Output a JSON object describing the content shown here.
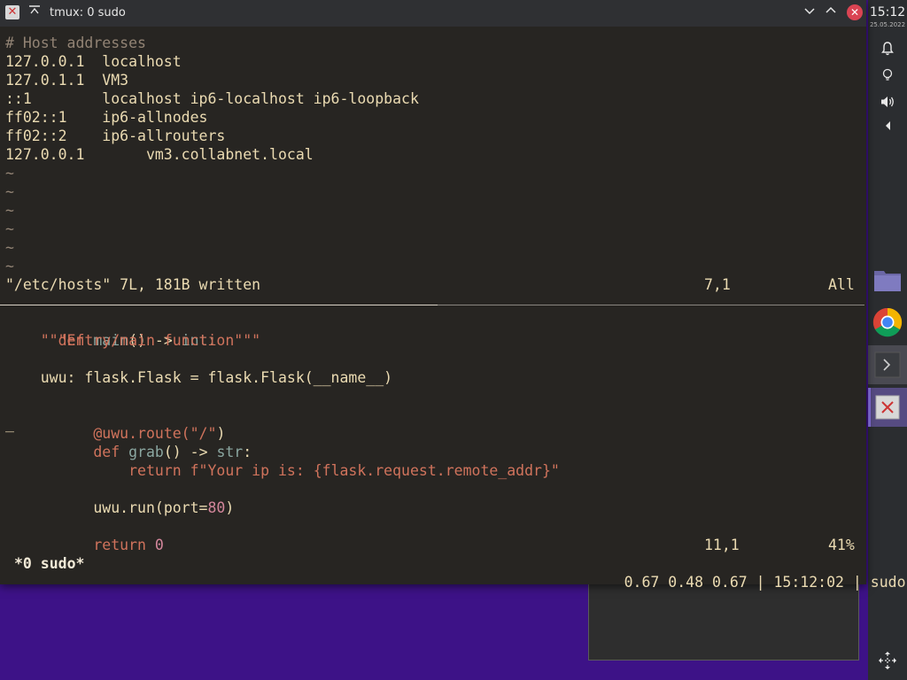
{
  "window": {
    "title": "tmux: 0 sudo"
  },
  "top_pane": {
    "lines": [
      "# Host addresses",
      "127.0.0.1  localhost",
      "127.0.1.1  VM3",
      "::1        localhost ip6-localhost ip6-loopback",
      "ff02::1    ip6-allnodes",
      "ff02::2    ip6-allrouters",
      "127.0.0.1       vm3.collabnet.local"
    ],
    "tilde": "~",
    "status_message": "\"/etc/hosts\" 7L, 181B written",
    "cursor_pos": "7,1",
    "scroll": "All"
  },
  "bottom_pane": {
    "code": {
      "l1_kw": "def",
      "l1_name": "main",
      "l1_rest": "() -> ",
      "l1_type": "int",
      "l1_colon": ":",
      "l2": "    \"\"\"Entry/main function\"\"\"",
      "l4": "    uwu: flask.Flask = flask.Flask(__name__)",
      "l6_dec": "    @uwu.route(",
      "l6_str": "\"/\"",
      "l6_end": ")",
      "l7_kw": "    def",
      "l7_name": " grab",
      "l7_rest": "() -> ",
      "l7_type": "str",
      "l7_colon": ":",
      "l8_kw": "        return",
      "l8_str": " f\"Your ip is: {flask.request.remote_addr}\"",
      "l10_a": "    uwu.run(port=",
      "l10_num": "80",
      "l10_b": ")",
      "l12_kw": "    return",
      "l12_num": " 0"
    },
    "cursor_mark": "_",
    "cursor_pos": "11,1",
    "scroll": "41%"
  },
  "tmux_status": {
    "window_label": "*0 sudo*",
    "load": "0.67 0.48 0.67",
    "sep1": "|",
    "time": "15:12:02",
    "sep2": "|",
    "session": "sudo"
  },
  "panel": {
    "time": "15:12",
    "date": "25.05.2022"
  }
}
